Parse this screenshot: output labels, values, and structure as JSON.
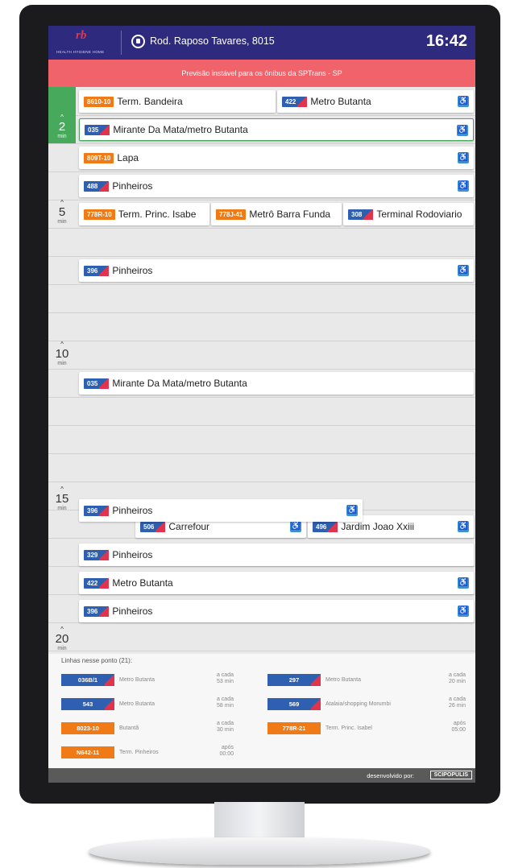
{
  "header": {
    "logo_text": "rb",
    "logo_tagline": "HEALTH HYGIENE HOME",
    "stop_name": "Rod. Raposo Tavares, 8015",
    "clock": "16:42"
  },
  "alert": {
    "text": "Previsão instável para os ônibus da SPTrans - SP"
  },
  "time_labels": [
    {
      "value": "2",
      "unit": "min"
    },
    {
      "value": "5",
      "unit": "min"
    },
    {
      "value": "10",
      "unit": "min"
    },
    {
      "value": "15",
      "unit": "min"
    },
    {
      "value": "20",
      "unit": "min"
    }
  ],
  "arrivals": [
    {
      "line": "8610-10",
      "dest": "Term. Bandeira"
    },
    {
      "line": "422",
      "dest": "Metro Butanta"
    },
    {
      "line": "035",
      "dest": "Mirante Da Mata/metro Butanta"
    },
    {
      "line": "809T-10",
      "dest": "Lapa"
    },
    {
      "line": "488",
      "dest": "Pinheiros"
    },
    {
      "line": "778R-10",
      "dest": "Term. Princ. Isabe"
    },
    {
      "line": "778J-41",
      "dest": "Metrô Barra Funda"
    },
    {
      "line": "308",
      "dest": "Terminal Rodoviario"
    },
    {
      "line": "396",
      "dest": "Pinheiros"
    },
    {
      "line": "035",
      "dest": "Mirante Da Mata/metro Butanta"
    },
    {
      "line": "396",
      "dest": "Pinheiros"
    },
    {
      "line": "506",
      "dest": "Carrefour"
    },
    {
      "line": "496",
      "dest": "Jardim Joao Xxiii"
    },
    {
      "line": "329",
      "dest": "Pinheiros"
    },
    {
      "line": "422",
      "dest": "Metro Butanta"
    },
    {
      "line": "396",
      "dest": "Pinheiros"
    }
  ],
  "lines_panel": {
    "title": "Linhas nesse ponto (21):",
    "lines": [
      {
        "code": "036B/1",
        "dest": "Metro Butanta",
        "freq_a": "a cada",
        "freq_b": "53 min"
      },
      {
        "code": "297",
        "dest": "Metro Butanta",
        "freq_a": "a cada",
        "freq_b": "20 min"
      },
      {
        "code": "543",
        "dest": "Metro Butanta",
        "freq_a": "a cada",
        "freq_b": "58 min"
      },
      {
        "code": "569",
        "dest": "Atalaia/shopping Morumbi",
        "freq_a": "a cada",
        "freq_b": "26 min"
      },
      {
        "code": "8023-10",
        "dest": "Butantã",
        "freq_a": "a cada",
        "freq_b": "30 min"
      },
      {
        "code": "778R-21",
        "dest": "Term. Princ. Isabel",
        "freq_a": "após",
        "freq_b": "05:00"
      },
      {
        "code": "N642-11",
        "dest": "Term. Pinheiros",
        "freq_a": "após",
        "freq_b": "00:00"
      }
    ]
  },
  "credit": {
    "text": "desenvolvido por:",
    "brand": "SCIPOPULIS"
  },
  "colors": {
    "header_bg": "#2e2a7d",
    "alert_bg": "#f0636b",
    "now_band": "#47a95c",
    "badge_blue": "#2f5fb0",
    "badge_orange": "#f07a16",
    "accessible_icon": "#3f8fd8"
  },
  "icons": [
    "location-pin-icon",
    "wheelchair-accessible-icon",
    "scipopulis-logo-icon"
  ]
}
